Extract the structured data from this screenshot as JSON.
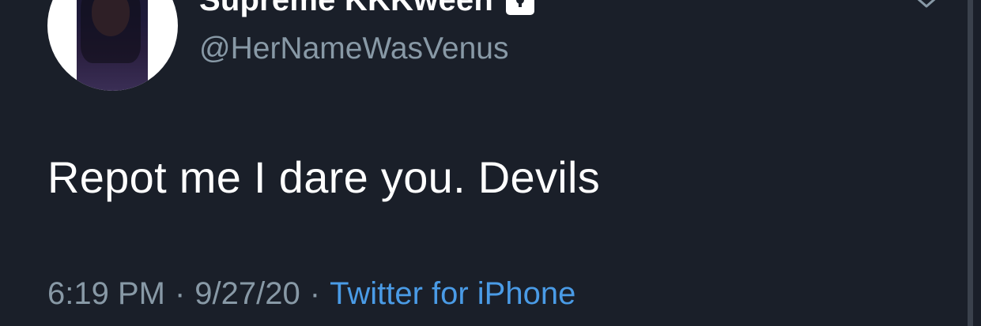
{
  "tweet": {
    "display_name": "Supreme KKKween",
    "handle": "@HerNameWasVenus",
    "text": "Repot me I dare you. Devils",
    "time": "6:19 PM",
    "date": "9/27/20",
    "separator": "·",
    "source": "Twitter for iPhone"
  },
  "icons": {
    "lock": "lock-icon",
    "caret": "chevron-down-icon"
  },
  "colors": {
    "background": "#1a1f29",
    "primary_text": "#ffffff",
    "secondary_text": "#8899a6",
    "link": "#4a9be6"
  }
}
